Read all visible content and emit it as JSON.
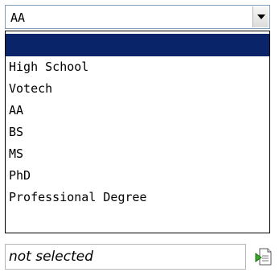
{
  "select": {
    "selected_value": "AA",
    "options": [
      "",
      "High School",
      "Votech",
      "AA",
      "BS",
      "MS",
      "PhD",
      "Professional Degree"
    ],
    "highlighted_index": 0
  },
  "status_field": {
    "value": "not selected"
  },
  "icons": {
    "dropdown_arrow": "chevron-down-icon",
    "picker": "document-arrow-icon"
  },
  "colors": {
    "highlight": "#0a246a",
    "border": "#7f9db9"
  }
}
